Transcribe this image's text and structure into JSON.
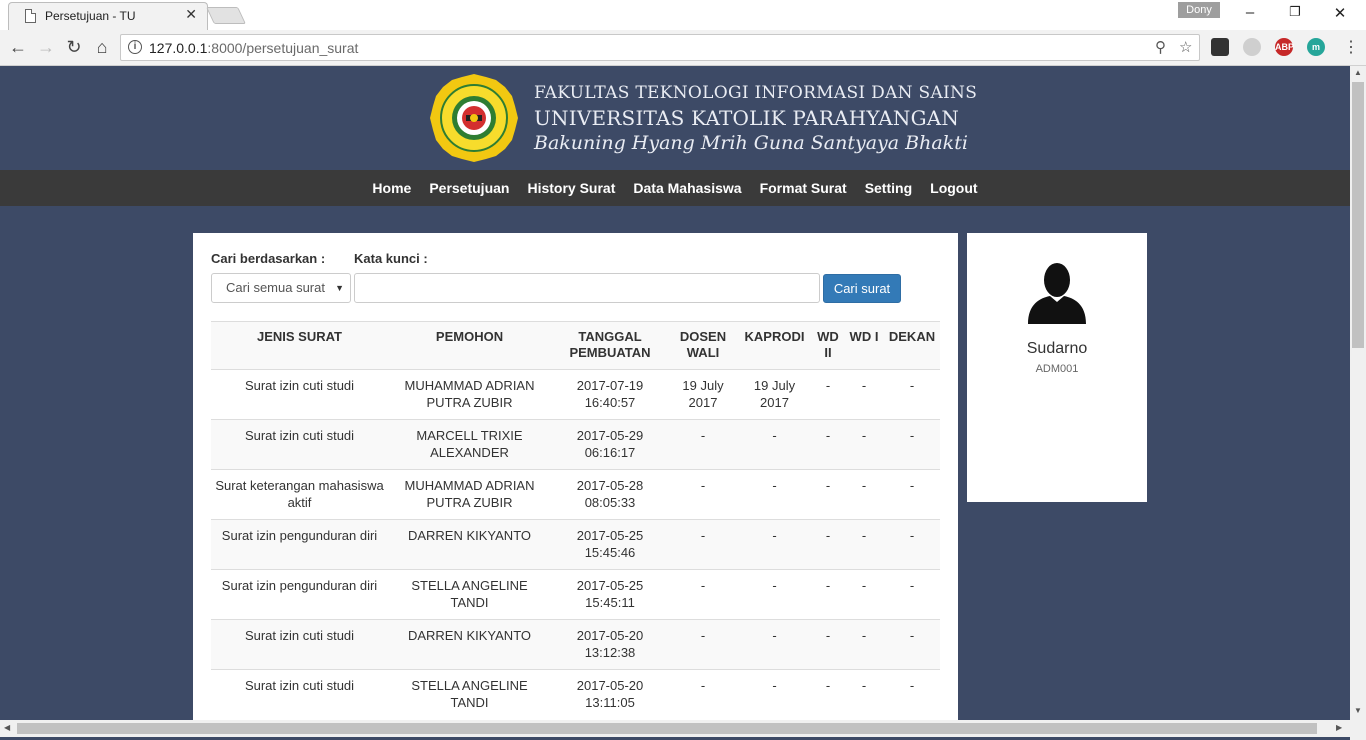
{
  "browser": {
    "tab_title": "Persetujuan - TU",
    "tab_close": "✕",
    "profile_name": "Dony",
    "url_host": "127.0.0.1",
    "url_path": ":8000/persetujuan_surat",
    "info": "i"
  },
  "header": {
    "line1": "FAKULTAS TEKNOLOGI INFORMASI DAN SAINS",
    "line2": "UNIVERSITAS KATOLIK PARAHYANGAN",
    "line3": "Bakuning Hyang Mrih Guna Santyaya Bhakti"
  },
  "menu": [
    "Home",
    "Persetujuan",
    "History Surat",
    "Data Mahasiswa",
    "Format Surat",
    "Setting",
    "Logout"
  ],
  "search": {
    "by_label": "Cari berdasarkan :",
    "keyword_label": "Kata kunci :",
    "select_value": "Cari semua surat",
    "keyword_value": "",
    "button_label": "Cari surat"
  },
  "table": {
    "headers": [
      "JENIS SURAT",
      "PEMOHON",
      "TANGGAL PEMBUATAN",
      "DOSEN WALI",
      "KAPRODI",
      "WD II",
      "WD I",
      "DEKAN"
    ],
    "rows": [
      [
        "Surat izin cuti studi",
        "MUHAMMAD ADRIAN PUTRA ZUBIR",
        "2017-07-19 16:40:57",
        "19 July 2017",
        "19 July 2017",
        "-",
        "-",
        "-"
      ],
      [
        "Surat izin cuti studi",
        "MARCELL TRIXIE ALEXANDER",
        "2017-05-29 06:16:17",
        "-",
        "-",
        "-",
        "-",
        "-"
      ],
      [
        "Surat keterangan mahasiswa aktif",
        "MUHAMMAD ADRIAN PUTRA ZUBIR",
        "2017-05-28 08:05:33",
        "-",
        "-",
        "-",
        "-",
        "-"
      ],
      [
        "Surat izin pengunduran diri",
        "DARREN KIKYANTO",
        "2017-05-25 15:45:46",
        "-",
        "-",
        "-",
        "-",
        "-"
      ],
      [
        "Surat izin pengunduran diri",
        "STELLA ANGELINE TANDI",
        "2017-05-25 15:45:11",
        "-",
        "-",
        "-",
        "-",
        "-"
      ],
      [
        "Surat izin cuti studi",
        "DARREN KIKYANTO",
        "2017-05-20 13:12:38",
        "-",
        "-",
        "-",
        "-",
        "-"
      ],
      [
        "Surat izin cuti studi",
        "STELLA ANGELINE TANDI",
        "2017-05-20 13:11:05",
        "-",
        "-",
        "-",
        "-",
        "-"
      ]
    ]
  },
  "user": {
    "name": "Sudarno",
    "id": "ADM001"
  },
  "colors": {
    "page_bg": "#3d4a66",
    "menubar_bg": "#3a3a3a",
    "primary_button": "#337ab7"
  }
}
